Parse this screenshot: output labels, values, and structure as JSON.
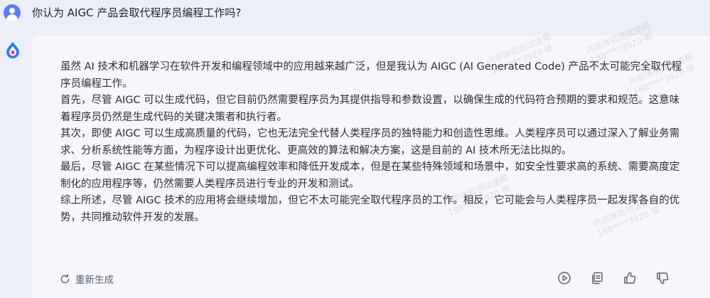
{
  "question": {
    "text": "你认为 AIGC 产品会取代程序员编程工作吗?"
  },
  "answer": {
    "paragraphs": [
      "虽然 AI 技术和机器学习在软件开发和编程领域中的应用越来越广泛，但是我认为 AIGC (AI Generated Code) 产品不太可能完全取代程序员编程工作。",
      "首先，尽管 AIGC 可以生成代码，但它目前仍然需要程序员为其提供指导和参数设置，以确保生成的代码符合预期的要求和规范。这意味着程序员仍然是生成代码的关键决策者和执行者。",
      "其次，即使 AIGC 可以生成高质量的代码，它也无法完全代替人类程序员的独特能力和创造性思维。人类程序员可以通过深入了解业务需求、分析系统性能等方面，为程序设计出更优化、更高效的算法和解决方案，这是目前的 AI 技术所无法比拟的。",
      "最后，尽管 AIGC 在某些情况下可以提高编程效率和降低开发成本，但是在某些特殊领域和场景中，如安全性要求高的系统、需要高度定制化的应用程序等，仍然需要人类程序员进行专业的开发和测试。",
      "综上所述，尽管 AIGC 技术的应用将会继续增加，但它不太可能完全取代程序员的工作。相反，它可能会与人类程序员一起发挥各自的优势，共同推动软件开发的发展。"
    ],
    "regenerate_label": "重新生成"
  },
  "icons": {
    "user_avatar": "user-avatar-icon",
    "bot_avatar": "bot-logo-icon",
    "regenerate": "refresh-icon",
    "play": "play-circle-icon",
    "copy": "copy-icon",
    "like": "thumbs-up-icon",
    "dislike": "thumbs-down-icon"
  },
  "colors": {
    "page_bg": "#eceef8",
    "card_bg": "#f6f7fb",
    "user_avatar": "#5a7dff",
    "logo_blue": "#2f7cf6",
    "logo_red": "#f0443a",
    "icon_gray": "#5b6070"
  },
  "watermark": {
    "line1": "内部体验测试使用",
    "line2": "188****3920 哪"
  }
}
